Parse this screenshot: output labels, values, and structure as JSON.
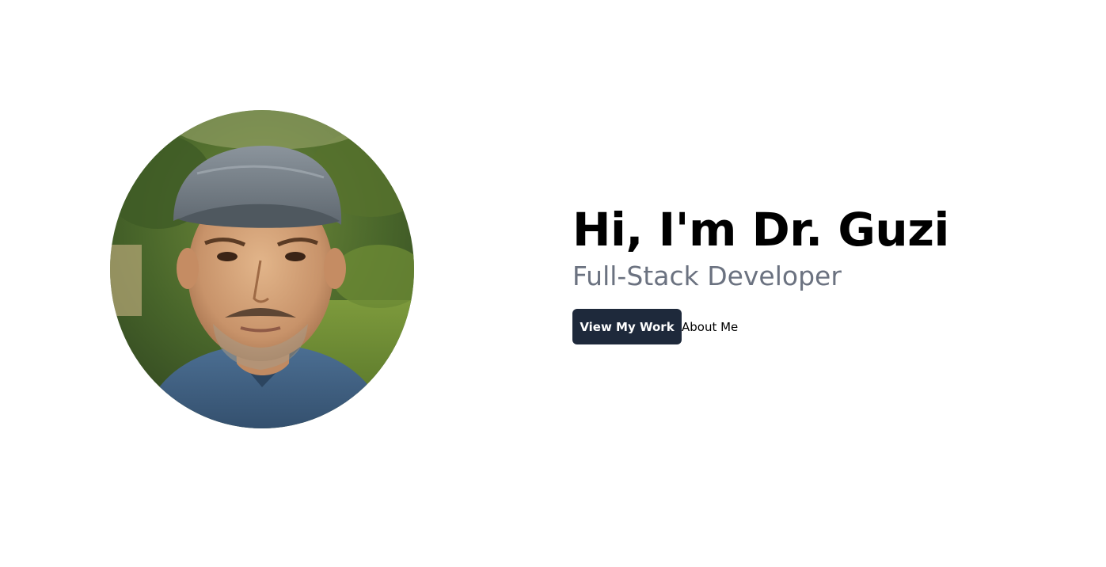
{
  "hero": {
    "portrait_alt": "Portrait of Dr. Guzi",
    "headline": "Hi, I'm Dr. Guzi",
    "role": "Full-Stack Developer",
    "primary_button": "View My Work",
    "secondary_link": "About Me"
  },
  "colors": {
    "background": "#ffffff",
    "headline": "#000000",
    "role_text": "#6b7280",
    "button_bg": "#1e293b",
    "button_text": "#ffffff"
  }
}
